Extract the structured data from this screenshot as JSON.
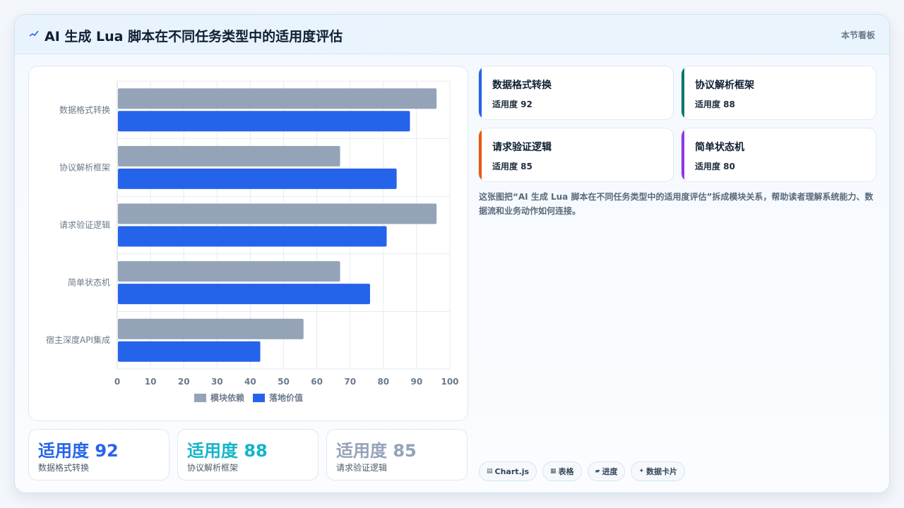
{
  "header": {
    "title": "AI 生成 Lua 脚本在不同任务类型中的适用度评估",
    "tag": "本节看板",
    "icon": "sparkline-icon"
  },
  "chart_data": {
    "type": "bar",
    "orientation": "horizontal",
    "categories": [
      "数据格式转换",
      "协议解析框架",
      "请求验证逻辑",
      "简单状态机",
      "宿主深度API集成"
    ],
    "series": [
      {
        "name": "模块依赖",
        "color": "#94a3b8",
        "values": [
          96,
          67,
          96,
          67,
          56
        ]
      },
      {
        "name": "落地价值",
        "color": "#2563eb",
        "values": [
          88,
          84,
          81,
          76,
          43
        ]
      }
    ],
    "xlim": [
      0,
      100
    ],
    "xticks": [
      "0",
      "10",
      "20",
      "30",
      "40",
      "50",
      "60",
      "70",
      "80",
      "90",
      "100"
    ],
    "grid": true,
    "legend": "bottom"
  },
  "stats": [
    {
      "value": "适用度 92",
      "label": "数据格式转换",
      "color": "#2563eb"
    },
    {
      "value": "适用度 88",
      "label": "协议解析框架",
      "color": "#12b5c9"
    },
    {
      "value": "适用度 85",
      "label": "请求验证逻辑",
      "color": "#94a3b8"
    }
  ],
  "cards": [
    {
      "name": "数据格式转换",
      "value": "适用度 92",
      "color": "#2563eb"
    },
    {
      "name": "协议解析框架",
      "value": "适用度 88",
      "color": "#0f766e"
    },
    {
      "name": "请求验证逻辑",
      "value": "适用度 85",
      "color": "#ea580c"
    },
    {
      "name": "简单状态机",
      "value": "适用度 80",
      "color": "#9333ea"
    }
  ],
  "description": "这张图把“AI 生成 Lua 脚本在不同任务类型中的适用度评估”拆成模块关系，帮助读者理解系统能力、数据流和业务动作如何连接。",
  "chips": [
    {
      "icon": "chart-icon",
      "label": "Chart.js"
    },
    {
      "icon": "table-icon",
      "label": "表格"
    },
    {
      "icon": "progress-icon",
      "label": "进度"
    },
    {
      "icon": "card-icon",
      "label": "数据卡片"
    }
  ]
}
